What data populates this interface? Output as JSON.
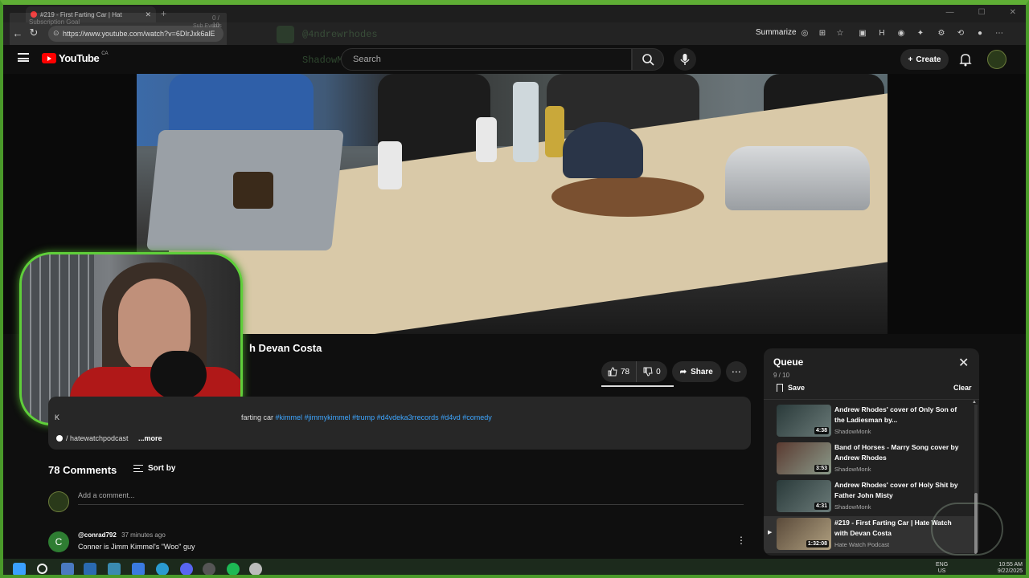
{
  "browser": {
    "tab_title": "#219 - First Farting Car | Hat",
    "url": "https://www.youtube.com/watch?v=6DIrJxk6alE",
    "summarize_label": "Summarize"
  },
  "overlay": {
    "subscription_goal": "Subscription Goal",
    "goal_count": "0 / 10",
    "sub_events": "Sub Events",
    "ghost_user_1": "@4ndrewrhodes",
    "ghost_user_2": "ShadowM"
  },
  "youtube": {
    "logo_text": "YouTube",
    "region": "CA",
    "search_placeholder": "Search",
    "create_label": "Create"
  },
  "video": {
    "title_visible": "h Devan Costa",
    "likes": "78",
    "dislikes": "0",
    "share_label": "Share"
  },
  "description": {
    "line_prefix": "K",
    "line_text": "farting car",
    "tags": [
      "#kimmel",
      "#jimmykimmel",
      "#trump",
      "#d4vdeka3rrecords",
      "#d4vd",
      "#comedy"
    ],
    "link_text": "/ hatewatchpodcast",
    "more_label": "...more"
  },
  "comments": {
    "count_label": "78 Comments",
    "sort_label": "Sort by",
    "add_placeholder": "Add a comment...",
    "items": [
      {
        "avatar_letter": "C",
        "user": "@conrad792",
        "time": "37 minutes ago",
        "text": "Conner is Jimm Kimmel's \"Woo\" guy"
      }
    ]
  },
  "queue": {
    "title": "Queue",
    "count": "9 / 10",
    "save_label": "Save",
    "clear_label": "Clear",
    "items": [
      {
        "title": "Andrew Rhodes' cover of Only Son of the Ladiesman by...",
        "channel": "ShadowMonk",
        "duration": "4:38"
      },
      {
        "title": "Band of Horses - Marry Song cover by Andrew Rhodes",
        "channel": "ShadowMonk",
        "duration": "3:53"
      },
      {
        "title": "Andrew Rhodes' cover of Holy Shit by Father John Misty",
        "channel": "ShadowMonk",
        "duration": "4:31"
      },
      {
        "title": "#219 - First Farting Car | Hate Watch with Devan Costa",
        "channel": "Hate Watch Podcast",
        "duration": "1:32:08",
        "active": true
      }
    ]
  },
  "taskbar": {
    "lang_top": "ENG",
    "lang_bottom": "US",
    "time": "10:55 AM",
    "date": "9/22/2025"
  },
  "colors": {
    "accent_green": "#5fae35",
    "youtube_red": "#ff0000",
    "link_blue": "#3ea6ff"
  }
}
